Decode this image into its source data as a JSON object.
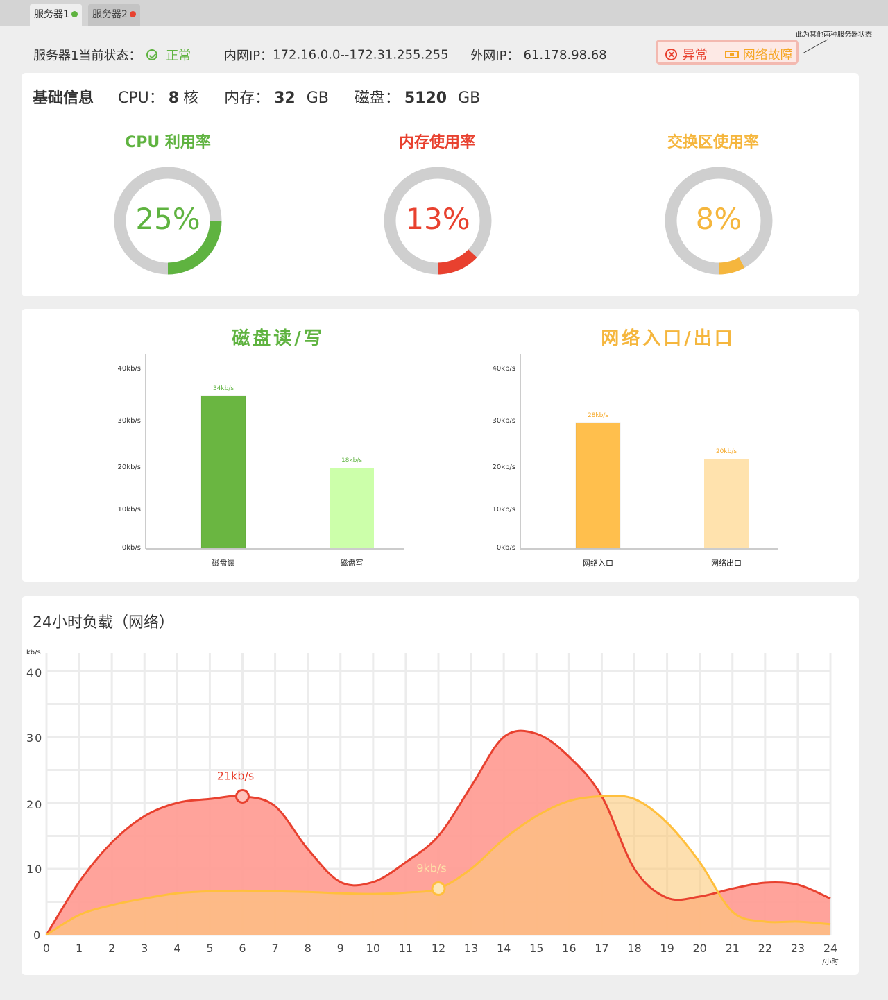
{
  "tabs": [
    {
      "label": "服务器1",
      "status_color": "#5fb340",
      "active": true
    },
    {
      "label": "服务器2",
      "status_color": "#e8412f",
      "active": false
    }
  ],
  "status": {
    "prefix": "服务器1当前状态：",
    "state": "正常",
    "intranet_label": "内网IP：",
    "intranet_value": "172.16.0.0--172.31.255.255",
    "extranet_label": "外网IP：",
    "extranet_value": "61.178.98.68"
  },
  "legend": {
    "abnormal": "异常",
    "network_fault": "网络故障",
    "note": "此为其他两种服务器状态"
  },
  "basic": {
    "title": "基础信息",
    "cpu_label": "CPU：",
    "cpu_value": "8",
    "cpu_unit": "核",
    "mem_label": "内存：",
    "mem_value": "32",
    "mem_unit": "GB",
    "disk_label": "磁盘：",
    "disk_value": "5120",
    "disk_unit": "GB"
  },
  "gauges": [
    {
      "title": "CPU 利用率",
      "percent": 25,
      "label": "25%",
      "color": "#5fb340"
    },
    {
      "title": "内存使用率",
      "percent": 13,
      "label": "13%",
      "color": "#e8412f"
    },
    {
      "title": "交换区使用率",
      "percent": 8,
      "label": "8%",
      "color": "#f5b63d"
    }
  ],
  "colors": {
    "disk_read": "#6ab641",
    "disk_write": "#ccffaa",
    "net_in": "#ffbf4d",
    "net_out": "#ffe2ad",
    "load_red": "#e8412f",
    "load_red_fill": "#ff9e96",
    "load_orange": "#ffbf3d",
    "load_orange_fill": "#fcc97a",
    "grid": "#ececec"
  },
  "chart_data": [
    {
      "type": "bar",
      "title": "磁盘读/写",
      "categories": [
        "磁盘读",
        "磁盘写"
      ],
      "values": [
        34,
        18
      ],
      "value_labels": [
        "34kb/s",
        "18kb/s"
      ],
      "yticks": [
        "0kb/s",
        "10kb/s",
        "20kb/s",
        "30kb/s",
        "40kb/s"
      ],
      "ylim": [
        0,
        40
      ]
    },
    {
      "type": "bar",
      "title": "网络入口/出口",
      "categories": [
        "网络入口",
        "网络出口"
      ],
      "values": [
        28,
        20
      ],
      "value_labels": [
        "28kb/s",
        "20kb/s"
      ],
      "yticks": [
        "0kb/s",
        "10kb/s",
        "20kb/s",
        "30kb/s",
        "40kb/s"
      ],
      "ylim": [
        0,
        40
      ]
    },
    {
      "type": "area",
      "title": "24小时负载（网络）",
      "ylabel": "kb/s",
      "xlabel": "/小时",
      "x": [
        0,
        1,
        2,
        3,
        4,
        5,
        6,
        7,
        8,
        9,
        10,
        11,
        12,
        13,
        14,
        15,
        16,
        17,
        18,
        19,
        20,
        21,
        22,
        23,
        24
      ],
      "xlim": [
        0,
        24
      ],
      "ylim": [
        0,
        40
      ],
      "yticks": [
        "0",
        "10",
        "20",
        "30",
        "40"
      ],
      "series": [
        {
          "values": [
            0,
            8,
            14,
            18,
            20,
            20.6,
            21,
            19.5,
            13,
            8,
            8,
            11,
            15,
            22.5,
            30,
            30.5,
            27,
            21,
            10,
            5.6,
            5.8,
            7,
            7.9,
            7.6,
            5.5
          ],
          "highlight_index": 6,
          "highlight_label": "21kb/s"
        },
        {
          "values": [
            0,
            3,
            4.5,
            5.5,
            6.3,
            6.6,
            6.7,
            6.6,
            6.5,
            6.3,
            6.2,
            6.4,
            7,
            10,
            14.5,
            18,
            20.3,
            21,
            20.6,
            17,
            11,
            3.5,
            2,
            2,
            1.6
          ],
          "highlight_index": 12,
          "highlight_label": "9kb/s"
        }
      ]
    }
  ]
}
